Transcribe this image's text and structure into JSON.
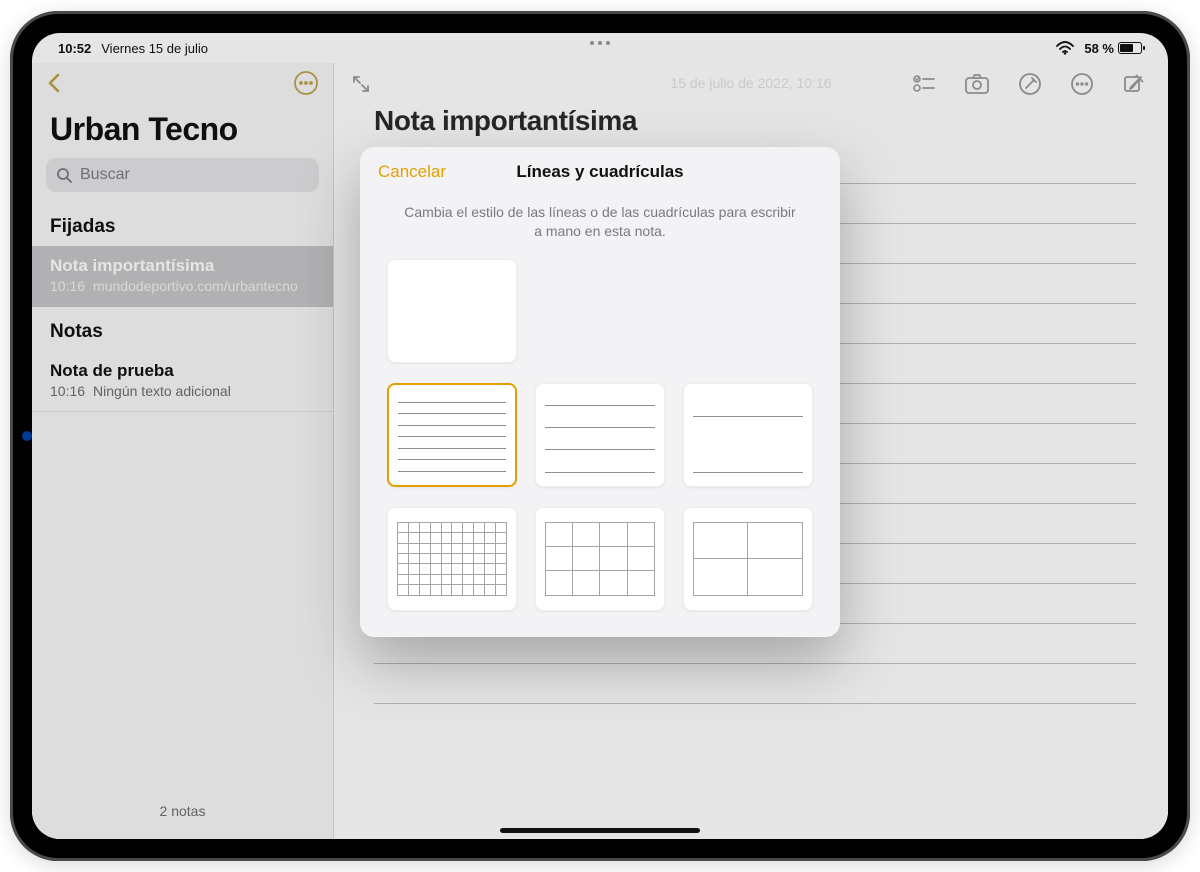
{
  "status": {
    "time": "10:52",
    "date": "Viernes 15 de julio",
    "battery_pct": "58 %"
  },
  "sidebar": {
    "folder_title": "Urban Tecno",
    "search_placeholder": "Buscar",
    "sections": {
      "pinned_label": "Fijadas",
      "notes_label": "Notas"
    },
    "pinned": [
      {
        "title": "Nota importantísima",
        "time": "10:16",
        "preview": "mundodeportivo.com/urbantecno"
      }
    ],
    "notes": [
      {
        "title": "Nota de prueba",
        "time": "10:16",
        "preview": "Ningún texto adicional"
      }
    ],
    "footer_count": "2 notas"
  },
  "note": {
    "title": "Nota importantísima",
    "date_line": "15 de julio de 2022, 10:16"
  },
  "sheet": {
    "cancel": "Cancelar",
    "title": "Líneas y cuadrículas",
    "subtitle": "Cambia el estilo de las líneas o de las cuadrículas para escribir a mano en esta nota.",
    "options": [
      {
        "id": "none",
        "kind": "blank",
        "selected": false
      },
      {
        "id": "lines-narrow",
        "kind": "lines",
        "density": 7,
        "selected": true
      },
      {
        "id": "lines-medium",
        "kind": "lines",
        "density": 4,
        "selected": false
      },
      {
        "id": "lines-wide",
        "kind": "lines",
        "density": 2,
        "selected": false
      },
      {
        "id": "grid-small",
        "kind": "grid",
        "cols": 10,
        "rows": 7,
        "selected": false
      },
      {
        "id": "grid-medium",
        "kind": "grid",
        "cols": 4,
        "rows": 3,
        "selected": false
      },
      {
        "id": "grid-large",
        "kind": "grid",
        "cols": 2,
        "rows": 2,
        "selected": false
      }
    ]
  },
  "icons": {
    "back": "chevron-left-icon",
    "more_circle": "ellipsis-circle-icon",
    "expand": "expand-arrows-icon",
    "checklist": "checklist-icon",
    "camera": "camera-icon",
    "markup": "pen-circle-icon",
    "more": "ellipsis-circle-icon",
    "compose": "compose-icon",
    "search": "magnifying-glass-icon",
    "wifi": "wifi-icon",
    "battery": "battery-icon"
  }
}
